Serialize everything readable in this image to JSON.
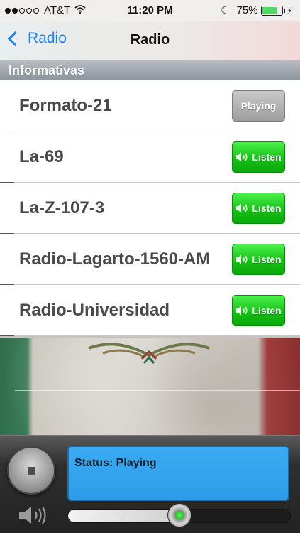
{
  "status_bar": {
    "carrier": "AT&T",
    "time": "11:20 PM",
    "battery_percent": "75%",
    "battery_level": 0.75,
    "signal_bars_filled": 2,
    "signal_bars_total": 5
  },
  "nav": {
    "back_label": "Radio",
    "title": "Radio"
  },
  "section": {
    "title": "Informativas"
  },
  "stations": [
    {
      "name": "Formato-21",
      "button": "Playing",
      "state": "playing"
    },
    {
      "name": "La-69",
      "button": "Listen",
      "state": "listen"
    },
    {
      "name": "La-Z-107-3",
      "button": "Listen",
      "state": "listen"
    },
    {
      "name": "Radio-Lagarto-1560-AM",
      "button": "Listen",
      "state": "listen"
    },
    {
      "name": "Radio-Universidad",
      "button": "Listen",
      "state": "listen"
    }
  ],
  "player": {
    "status_text": "Status: Playing",
    "volume_level": 0.5
  },
  "colors": {
    "accent": "#1a82fb",
    "listen_button": "#14c214",
    "playing_button": "#a3a3a3",
    "status_panel": "#35a5ef"
  },
  "icons": {
    "back": "chevron-left-icon",
    "wifi": "wifi-icon",
    "moon": "moon-icon",
    "battery": "battery-icon",
    "charging": "bolt-icon",
    "speaker": "speaker-icon",
    "stop": "stop-icon"
  }
}
